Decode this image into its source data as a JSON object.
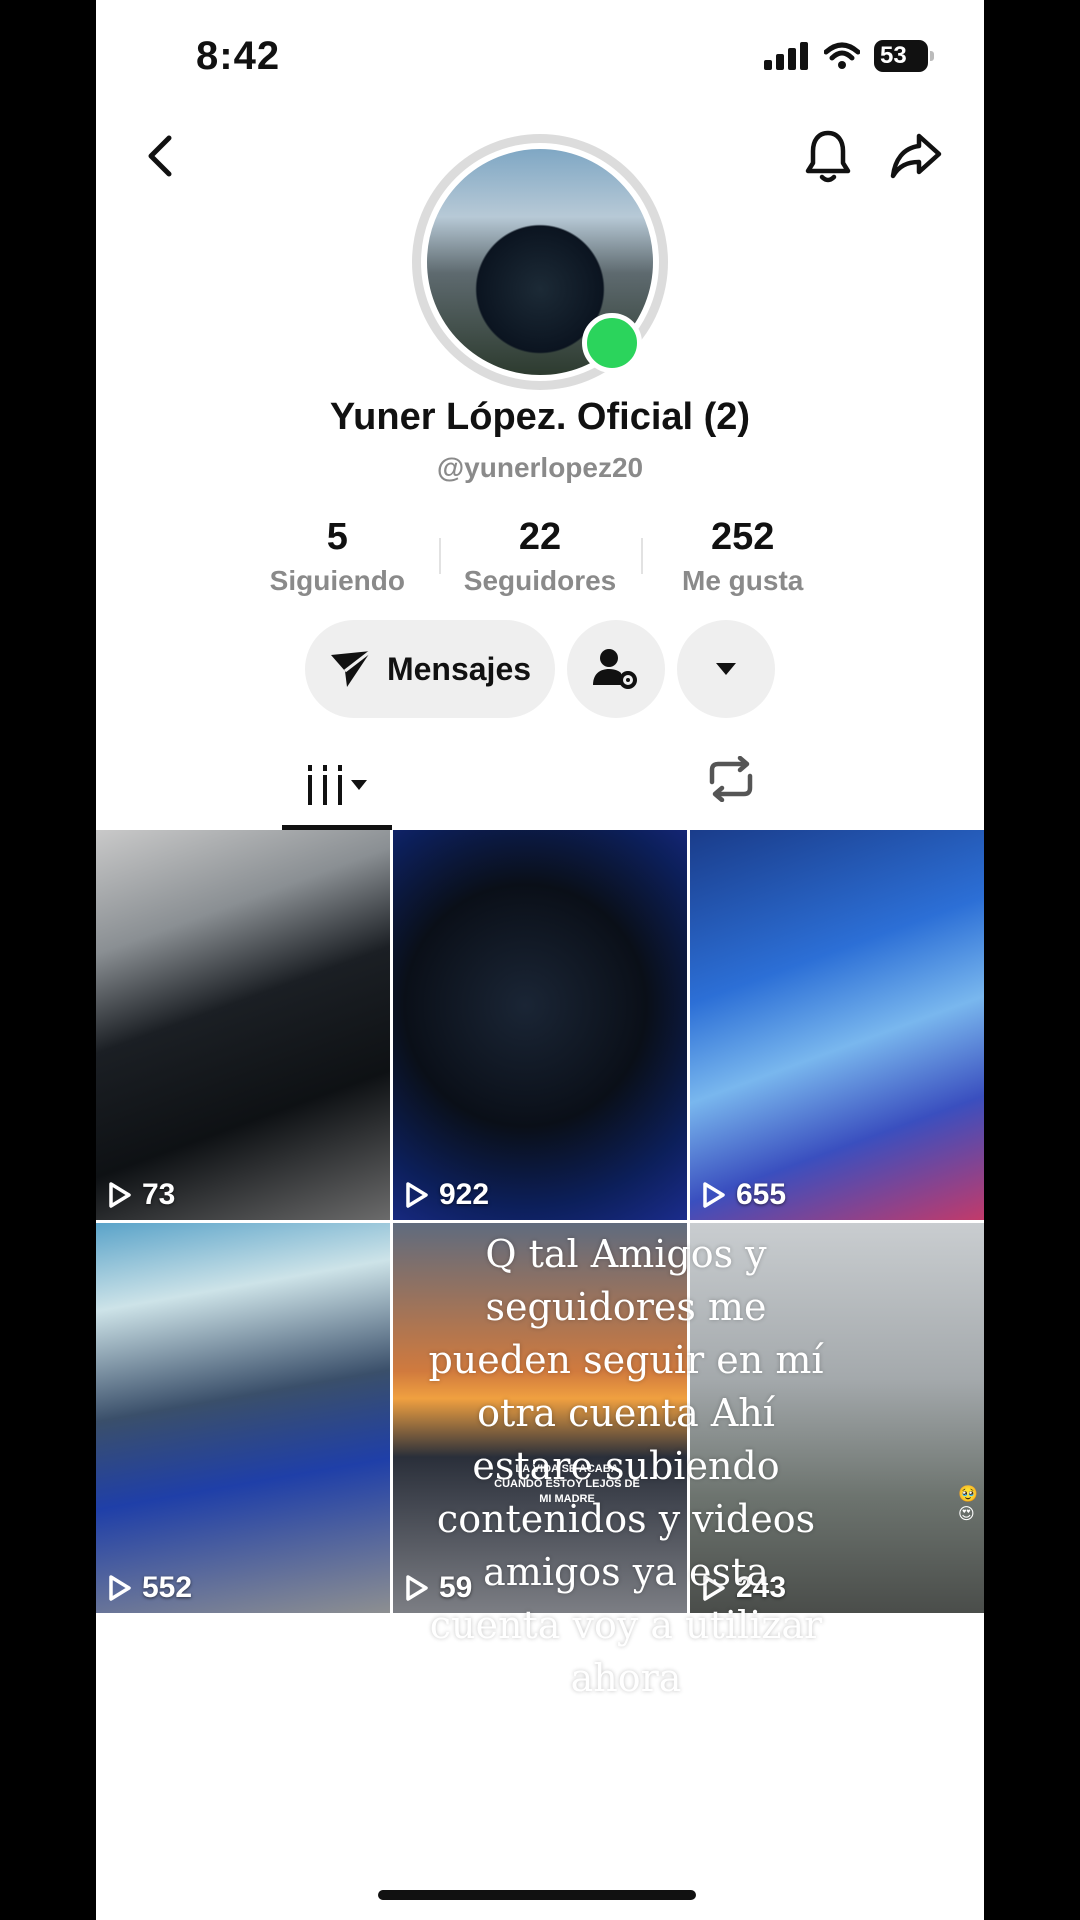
{
  "status_bar": {
    "time": "8:42",
    "battery": "53"
  },
  "profile": {
    "name": "Yuner López. Oficial (2)",
    "handle": "@yunerlopez20"
  },
  "stats": [
    {
      "value": "5",
      "label": "Siguiendo"
    },
    {
      "value": "22",
      "label": "Seguidores"
    },
    {
      "value": "252",
      "label": "Me gusta"
    }
  ],
  "actions": {
    "message_label": "Mensajes"
  },
  "videos": [
    {
      "views": "73"
    },
    {
      "views": "922"
    },
    {
      "views": "655"
    },
    {
      "views": "552"
    },
    {
      "views": "59"
    },
    {
      "views": "243"
    }
  ],
  "overlay_caption": "Q tal   Amigos y seguidores me pueden seguir en mí otra cuenta   Ahí estare subiendo contenidos y videos amigos ya esta cuenta voy a utilizar ahora",
  "tile_caption_small": "LA VIDA SE ACABA CUANDO ESTOY LEJOS DE MI MADRE",
  "tile_caption_emoji": "🥹😍",
  "colors": {
    "online": "#2bd45c",
    "text": "#111111",
    "muted": "#8a8a8a"
  }
}
